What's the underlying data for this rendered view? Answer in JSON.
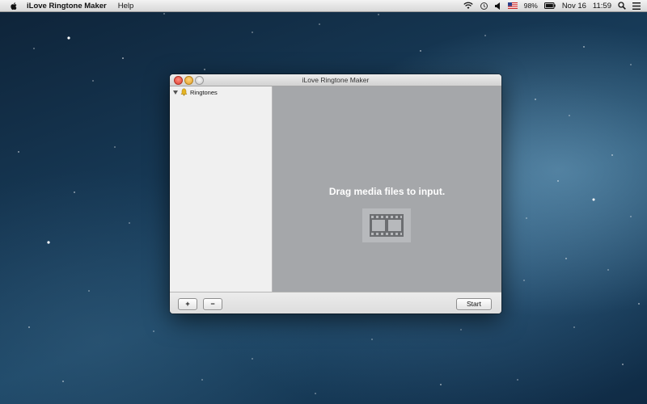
{
  "menubar": {
    "app_name": "iLove Ringtone Maker",
    "menus": [
      "Help"
    ],
    "status": {
      "battery": "98%",
      "date": "Nov 16",
      "time": "11:59"
    },
    "icons": [
      "apple-icon",
      "wifi-icon",
      "time-machine-icon",
      "volume-icon",
      "flag-icon",
      "battery-icon",
      "search-icon",
      "list-icon"
    ]
  },
  "window": {
    "title": "iLove Ringtone Maker",
    "sidebar": {
      "items": [
        {
          "label": "Ringtones",
          "icon": "bell-icon",
          "expanded": true
        }
      ]
    },
    "drop_area": {
      "message": "Drag media files to input.",
      "icon": "film-icon"
    },
    "bottom_bar": {
      "add_label": "+",
      "remove_label": "−",
      "start_label": "Start"
    }
  },
  "colors": {
    "drop_area_bg": "#a5a7aa",
    "sidebar_bg": "#f0f0f0"
  }
}
